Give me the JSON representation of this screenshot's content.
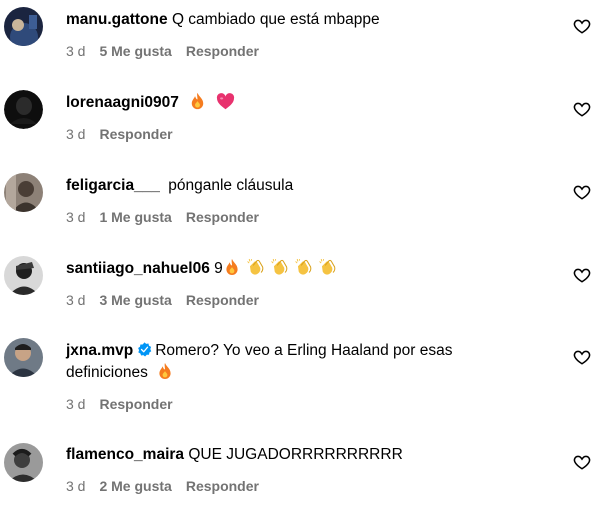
{
  "comments": [
    {
      "username": "manu.gattone",
      "text": "Q cambiado que está mbappe",
      "time": "3 d",
      "likes": "5 Me gusta",
      "reply": "Responder",
      "avatar_color": "#1d2a44"
    },
    {
      "username": "lorenaagni0907",
      "text": "",
      "emojis": [
        "fire-emoji",
        "pink-heart-emoji"
      ],
      "time": "3 d",
      "likes": "",
      "reply": "Responder",
      "avatar_color": "#111111"
    },
    {
      "username": "feligarcia___",
      "text": "pónganle cláusula",
      "time": "3 d",
      "likes": "1 Me gusta",
      "reply": "Responder",
      "avatar_color": "#6b5e55"
    },
    {
      "username": "santiiago_nahuel06",
      "text": "9",
      "emojis": [
        "fire-emoji",
        "clapping-hands-emoji",
        "clapping-hands-emoji",
        "clapping-hands-emoji",
        "clapping-hands-emoji"
      ],
      "time": "3 d",
      "likes": "3 Me gusta",
      "reply": "Responder",
      "avatar_color": "#2a2a2a"
    },
    {
      "username": "jxna.mvp",
      "verified": true,
      "text": "Romero? Yo veo a Erling Haaland por esas",
      "text2": "definiciones",
      "emojis2": [
        "fire-emoji"
      ],
      "time": "3 d",
      "likes": "",
      "reply": "Responder",
      "avatar_color": "#3a4350"
    },
    {
      "username": "flamenco_maira",
      "text": "QUE JUGADORRRRRRRRRR",
      "time": "3 d",
      "likes": "2 Me gusta",
      "reply": "Responder",
      "avatar_color": "#555555"
    }
  ],
  "colors": {
    "text": "#000000",
    "meta": "#737373",
    "verified": "#0095f6",
    "fire": "#f57c1f",
    "pink_heart": "#e8326e",
    "clap": "#f5c342"
  }
}
